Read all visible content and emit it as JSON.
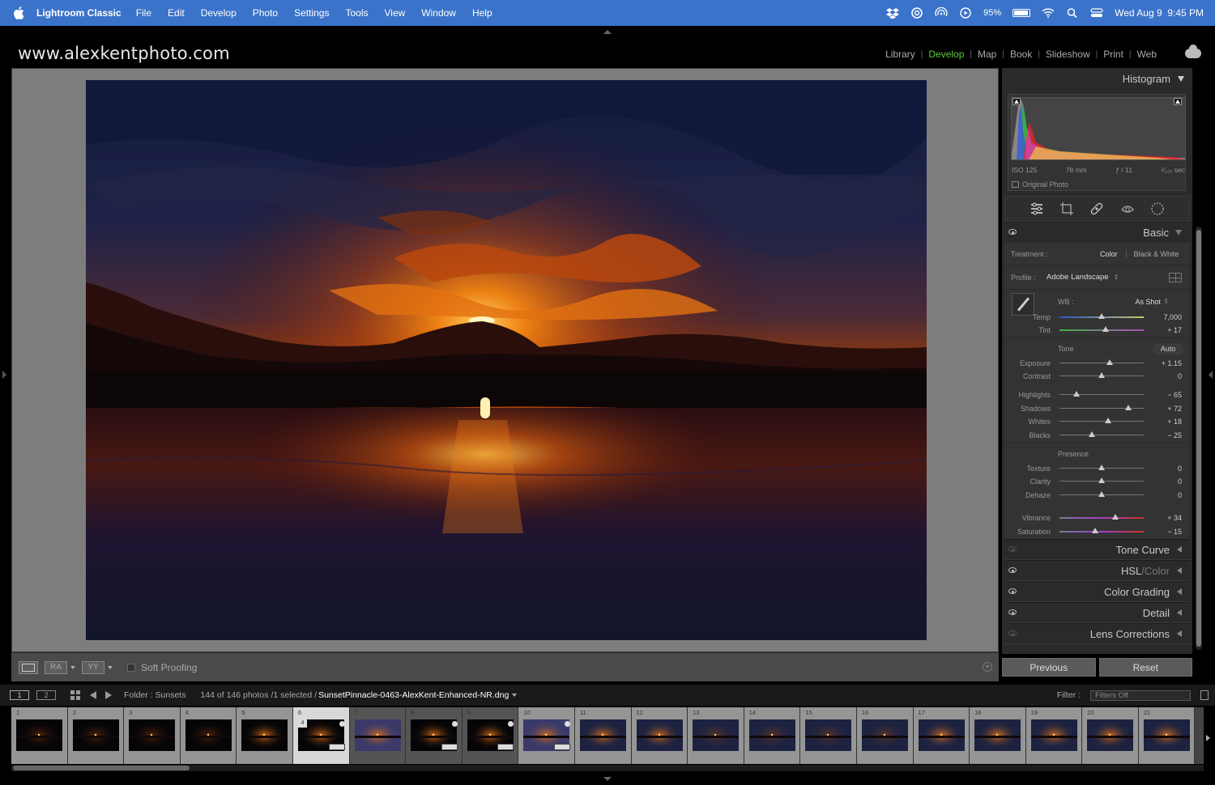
{
  "menubar": {
    "app_name": "Lightroom Classic",
    "items": [
      "File",
      "Edit",
      "Develop",
      "Photo",
      "Settings",
      "Tools",
      "View",
      "Window",
      "Help"
    ],
    "battery": "95%",
    "battery_level": 0.95,
    "datetime": "Wed Aug 9  9:45 PM"
  },
  "identity_plate": "www.alexkentphoto.com",
  "modules": {
    "items": [
      "Library",
      "Develop",
      "Map",
      "Book",
      "Slideshow",
      "Print",
      "Web"
    ],
    "active": "Develop"
  },
  "histogram": {
    "title": "Histogram",
    "iso": "ISO 125",
    "focal": "78 mm",
    "aperture": "ƒ / 11",
    "shutter": "¹⁄₁₂₅ sec",
    "original_photo": "Original Photo"
  },
  "basic": {
    "title": "Basic",
    "treatment_label": "Treatment :",
    "treatment_color": "Color",
    "treatment_bw": "Black & White",
    "profile_label": "Profile :",
    "profile_value": "Adobe Landscape",
    "wb_label": "WB :",
    "wb_value": "As Shot",
    "tone_title": "Tone",
    "auto": "Auto",
    "presence_title": "Presence",
    "sliders": {
      "temp": {
        "label": "Temp",
        "value": "7,000",
        "pos": 0.5
      },
      "tint": {
        "label": "Tint",
        "value": "+ 17",
        "pos": 0.55
      },
      "exposure": {
        "label": "Exposure",
        "value": "+ 1.15",
        "pos": 0.6
      },
      "contrast": {
        "label": "Contrast",
        "value": "0",
        "pos": 0.5
      },
      "highlights": {
        "label": "Highlights",
        "value": "− 65",
        "pos": 0.2
      },
      "shadows": {
        "label": "Shadows",
        "value": "+ 72",
        "pos": 0.82
      },
      "whites": {
        "label": "Whites",
        "value": "+ 18",
        "pos": 0.58
      },
      "blacks": {
        "label": "Blacks",
        "value": "− 25",
        "pos": 0.38
      },
      "texture": {
        "label": "Texture",
        "value": "0",
        "pos": 0.5
      },
      "clarity": {
        "label": "Clarity",
        "value": "0",
        "pos": 0.5
      },
      "dehaze": {
        "label": "Dehaze",
        "value": "0",
        "pos": 0.5
      },
      "vibrance": {
        "label": "Vibrance",
        "value": "+ 34",
        "pos": 0.66
      },
      "saturation": {
        "label": "Saturation",
        "value": "− 15",
        "pos": 0.42
      }
    }
  },
  "panels": {
    "tone_curve": "Tone Curve",
    "hsl": "HSL",
    "hsl_color": "Color",
    "hsl_sep": "/",
    "color_grading": "Color Grading",
    "detail": "Detail",
    "lens_corrections": "Lens Corrections"
  },
  "buttons": {
    "previous": "Previous",
    "reset": "Reset"
  },
  "toolbar": {
    "soft_proofing": "Soft Proofing",
    "ra": "RA",
    "yy": "YY"
  },
  "filmstrip_bar": {
    "screen1": "1",
    "screen2": "2",
    "folder": "Folder : Sunsets",
    "count": "144 of 146 photos /1 selected /",
    "filename": "SunsetPinnacle-0463-AlexKent-Enhanced-NR.dng",
    "filter_label": "Filter :",
    "filter_value": "Filters Off"
  },
  "filmstrip": {
    "cells": [
      {
        "num": "1"
      },
      {
        "num": "2"
      },
      {
        "num": "3"
      },
      {
        "num": "4"
      },
      {
        "num": "5"
      },
      {
        "num": "6",
        "selected": true,
        "badge": "4"
      },
      {
        "num": "7",
        "dark": true
      },
      {
        "num": "8",
        "dark": true
      },
      {
        "num": "9",
        "dark": true
      },
      {
        "num": "10"
      },
      {
        "num": "11"
      },
      {
        "num": "12"
      },
      {
        "num": "13"
      },
      {
        "num": "14"
      },
      {
        "num": "15"
      },
      {
        "num": "16"
      },
      {
        "num": "17"
      },
      {
        "num": "18"
      },
      {
        "num": "19"
      },
      {
        "num": "20"
      },
      {
        "num": "21"
      }
    ]
  },
  "colors": {
    "menubar": "#3a73c9",
    "develop_active": "#5ecb34"
  }
}
